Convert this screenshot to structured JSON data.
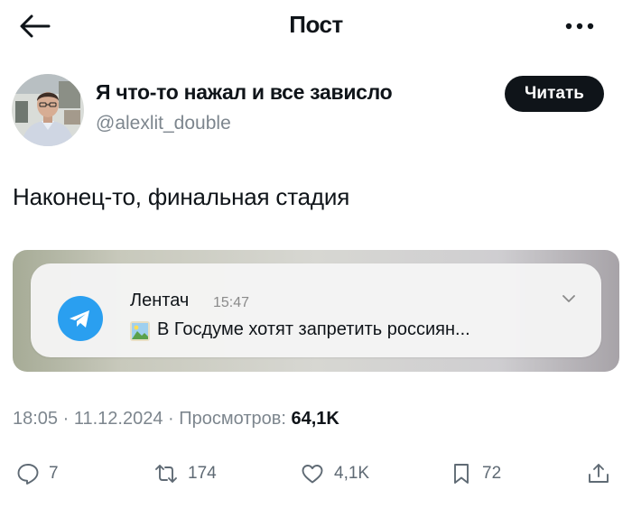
{
  "header": {
    "title": "Пост"
  },
  "author": {
    "name": "Я что-то нажал и все зависло",
    "handle": "@alexlit_double",
    "follow_label": "Читать"
  },
  "post": {
    "text": "Наконец-то, финальная стадия",
    "media": {
      "notification": {
        "sender": "Лентач",
        "time": "15:47",
        "message": "В Госдуме хотят запретить россиян..."
      }
    },
    "meta": {
      "time": "18:05",
      "dot1": "·",
      "date": "11.12.2024",
      "dot2": "·",
      "views_label": "Просмотров:",
      "views": "64,1K"
    }
  },
  "actions": {
    "replies": "7",
    "reposts": "174",
    "likes": "4,1K",
    "bookmarks": "72"
  },
  "colors": {
    "text": "#0f1419",
    "secondary": "#7d868e",
    "telegram_blue": "#2a9ff0",
    "button_bg": "#0f1419"
  }
}
